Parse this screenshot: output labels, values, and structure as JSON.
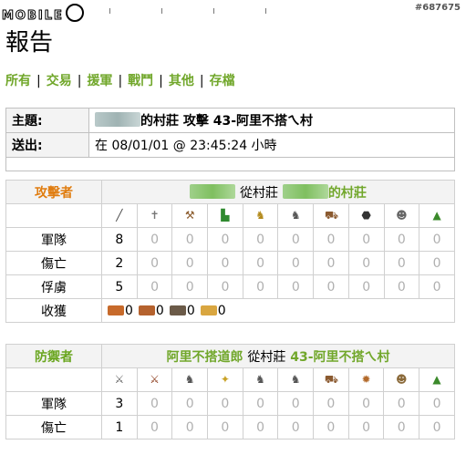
{
  "header": {
    "logo": "MOBILE",
    "post_id": "#687675"
  },
  "page_title": "報告",
  "menu": [
    "所有",
    "交易",
    "援軍",
    "戰鬥",
    "其他",
    "存檔"
  ],
  "report": {
    "subject_label": "主題:",
    "subject_suffix": "的村莊 攻擊 43-阿里不搭ㄟ村",
    "sent_label": "送出:",
    "sent_value": "在 08/01/01 @ 23:45:24 小時"
  },
  "attacker": {
    "role": "攻擊者",
    "from_word": "從村莊",
    "village_suffix": "的村莊",
    "unit_icons": [
      "club-icon",
      "spear-icon",
      "axe-icon",
      "scout-boot-icon",
      "paladin-horse-icon",
      "knight-horse-icon",
      "ram-icon",
      "catapult-icon",
      "chief-icon",
      "settler-icon"
    ],
    "rows": [
      {
        "label": "軍隊",
        "values": [
          "8",
          "0",
          "0",
          "0",
          "0",
          "0",
          "0",
          "0",
          "0",
          "0"
        ]
      },
      {
        "label": "傷亡",
        "values": [
          "2",
          "0",
          "0",
          "0",
          "0",
          "0",
          "0",
          "0",
          "0",
          "0"
        ]
      },
      {
        "label": "俘虜",
        "values": [
          "5",
          "0",
          "0",
          "0",
          "0",
          "0",
          "0",
          "0",
          "0",
          "0"
        ]
      }
    ],
    "loot_label": "收獲",
    "loot": [
      {
        "icon": "lumber-icon",
        "value": "0",
        "color": "#c76a2b"
      },
      {
        "icon": "clay-icon",
        "value": "0",
        "color": "#b5622e"
      },
      {
        "icon": "iron-icon",
        "value": "0",
        "color": "#6b5a48"
      },
      {
        "icon": "crop-icon",
        "value": "0",
        "color": "#d9a640"
      }
    ]
  },
  "defender": {
    "role": "防禦者",
    "player": "阿里不搭道郎",
    "from_word": "從村莊",
    "village": "43-阿里不搭ㄟ村",
    "unit_icons": [
      "legionnaire-icon",
      "praetorian-icon",
      "imperian-horse-icon",
      "scout-icon",
      "imperatoris-horse-icon",
      "caesaris-horse-icon",
      "battering-ram-icon",
      "fire-catapult-icon",
      "senator-icon",
      "settler-icon"
    ],
    "rows": [
      {
        "label": "軍隊",
        "values": [
          "3",
          "0",
          "0",
          "0",
          "0",
          "0",
          "0",
          "0",
          "0",
          "0"
        ]
      },
      {
        "label": "傷亡",
        "values": [
          "1",
          "0",
          "0",
          "0",
          "0",
          "0",
          "0",
          "0",
          "0",
          "0"
        ]
      }
    ]
  }
}
